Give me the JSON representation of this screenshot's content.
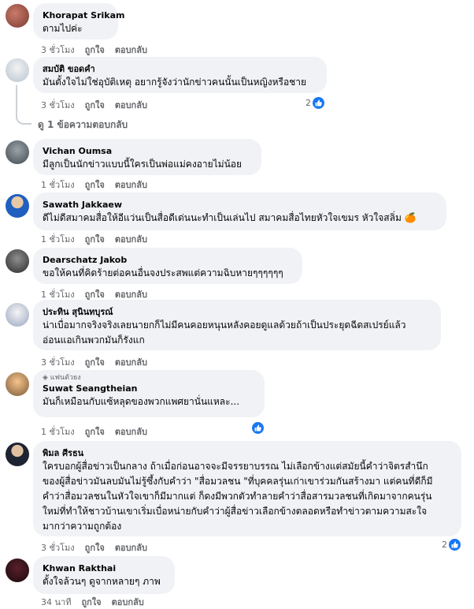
{
  "comments": [
    {
      "name": "Khorapat Srikam",
      "lines": [
        "ตามไปค่ะ"
      ],
      "time": "3 ชั่วโมง",
      "like": "ถูกใจ",
      "reply": "ตอบกลับ"
    },
    {
      "name": "สมบัติ ขอดคำ",
      "lines": [
        "มันตั้งใจไม่ใช่อุบัติเหตุ อยากรู้จังว่านักข่าวคนนั้นเป็นหญิงหรือชาย"
      ],
      "time": "3 ชั่วโมง",
      "like": "ถูกใจ",
      "reply": "ตอบกลับ",
      "reactions": "2",
      "replies_link": "ดู 1 ข้อความตอบกลับ"
    },
    {
      "name": "Vichan Oumsa",
      "lines": [
        "มีลูกเป็นนักข่าวแบบนี้ใครเป็นพ่อแม่คงอายไม่น้อย"
      ],
      "time": "1 ชั่วโมง",
      "like": "ถูกใจ",
      "reply": "ตอบกลับ"
    },
    {
      "name": "Sawath Jakkaew",
      "lines": [
        "ดีไม่ดีสมาคมสื่อให้อีแว่นเป็นสื่อดีเด่นนะทำเป็นเล่นไป สมาคมสื่อไทยหัวใจเขมร หัวใจสลิ่ม"
      ],
      "emoji": "🍊",
      "time": "1 ชั่วโมง",
      "like": "ถูกใจ",
      "reply": "ตอบกลับ"
    },
    {
      "name": "Dearschatz Jakob",
      "lines": [
        "ขอให้คนที่คิดร้ายต่อคนอื่นจงประสพแต่ความฉิบหายๆๆๆๆๆๆ"
      ],
      "time": "1 ชั่วโมง",
      "like": "ถูกใจ",
      "reply": "ตอบกลับ"
    },
    {
      "name": "ประทิน สุนินทบุรณ์",
      "lines": [
        "น่าเบื่อมากจริงจริงเลยนายกก็ไม่มีคนคอยหนุนหลังคอยดูแลด้วยถ้าเป็นประยุดฉีดสเปรย์แล้ว",
        "อ่อนแอเกินพวกมันก็รังแก"
      ],
      "time": "3 ชั่วโมง",
      "like": "ถูกใจ",
      "reply": "ตอบกลับ"
    },
    {
      "name": "Suwat Seangtheian",
      "badge": "แฟนตัวยง",
      "lines": [
        "มันก็เหมือนกับแซ้หลุดของพวกแพศยานั่นแหละ..."
      ],
      "time": "1 ชั่วโมง",
      "like": "ถูกใจ",
      "reply": "ตอบกลับ"
    },
    {
      "name": "พิมล ศีรธน",
      "lines": [
        "ใครบอกผู้สื่อข่าวเป็นกลาง ถ้าเมื่อก่อนอาจจะมีจรรยาบรรณ ไม่เลือกข้างแต่สมัยนี้คำว่าจิตรสำนึก",
        "ของผู้สื่อข่าวมันลบมันไม่รู้ซึ้งกับคำว่า \"สื่อมวลชน \"ที่บุคคลรุ่นเก่าเขาร่วมกันสร้างมา แต่คนที่ดีก็มี",
        "คำว่าสื่อมวลชนในหัวใจเขาก็มีมากแต่ ก็ดงมีพวกตัวทำลายคำว่าสื่อสารมวลชนที่เกิดมาจากคนรุ่น",
        "ใหม่ที่ทำให้ชาวบ้านเขาเริ่มเบื่อหน่ายกับคำว่าผู้สื่อข่าวเลือกข้างตลอดหรือทำข่าวตามความสะใจ",
        "มากว่าความถูกต้อง"
      ],
      "time": "3 ชั่วโมง",
      "like": "ถูกใจ",
      "reply": "ตอบกลับ",
      "reactions": "2"
    },
    {
      "name": "Khwan Rakthai",
      "lines": [
        "ตั้งใจล้วนๆ ดูจากหลายๆ ภาพ"
      ],
      "time": "34 นาที",
      "like": "ถูกใจ",
      "reply": "ตอบกลับ"
    }
  ],
  "colors": {
    "bubble": "#f0f2f5",
    "like_blue": "#1877f2",
    "meta_gray": "#65676b"
  }
}
